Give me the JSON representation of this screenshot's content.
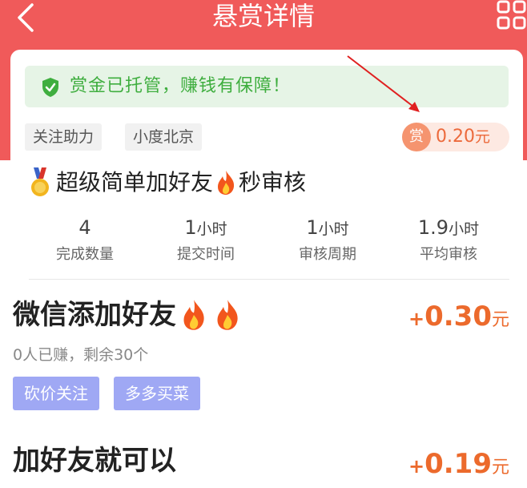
{
  "header": {
    "title": "悬赏详情"
  },
  "card": {
    "guarantee_text": "赏金已托管，赚钱有保障！",
    "tags": [
      "关注助力",
      "小度北京"
    ],
    "reward": {
      "badge": "赏",
      "amount": "0.20",
      "unit": "元"
    },
    "task_title_a": "超级简单加好友",
    "task_title_b": "秒审核",
    "stats": [
      {
        "value": "4",
        "unit": "",
        "label": "完成数量"
      },
      {
        "value": "1",
        "unit": "小时",
        "label": "提交时间"
      },
      {
        "value": "1",
        "unit": "小时",
        "label": "审核周期"
      },
      {
        "value": "1.9",
        "unit": "小时",
        "label": "平均审核"
      }
    ]
  },
  "items": [
    {
      "title": "微信添加好友",
      "price_plus": "+",
      "price": "0.30",
      "price_unit": "元",
      "subtitle": "0人已赚，剩余30个",
      "chips": [
        "砍价关注",
        "多多买菜"
      ]
    },
    {
      "title": "加好友就可以",
      "price_plus": "+",
      "price": "0.19",
      "price_unit": "元"
    }
  ],
  "colors": {
    "header_bg": "#f05a5a",
    "guarantee_green": "#3fae3f",
    "reward_orange": "#ec6a3c",
    "chip_purple": "#9fa8f4"
  },
  "icons": [
    "back-icon",
    "qr-code-icon",
    "shield-check-icon",
    "medal-icon",
    "fire-icon"
  ]
}
